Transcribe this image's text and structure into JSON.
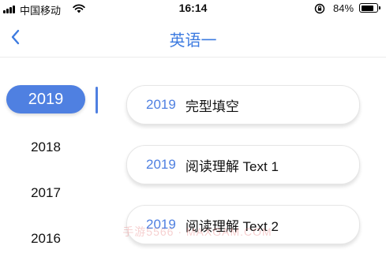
{
  "status_bar": {
    "carrier": "中国移动",
    "time": "16:14",
    "battery_percent": "84%",
    "battery_level": 0.84
  },
  "nav": {
    "title": "英语一",
    "back_icon": "chevron-left-icon"
  },
  "years": {
    "items": [
      "2019",
      "2018",
      "2017",
      "2016"
    ],
    "selected": "2019"
  },
  "cards": [
    {
      "year": "2019",
      "title": "完型填空"
    },
    {
      "year": "2019",
      "title": "阅读理解 Text 1"
    },
    {
      "year": "2019",
      "title": "阅读理解 Text 2"
    }
  ],
  "watermark": "手游5566 · MAXGAM.COM",
  "colors": {
    "accent": "#4f80e1",
    "title_blue": "#3d7be0"
  }
}
